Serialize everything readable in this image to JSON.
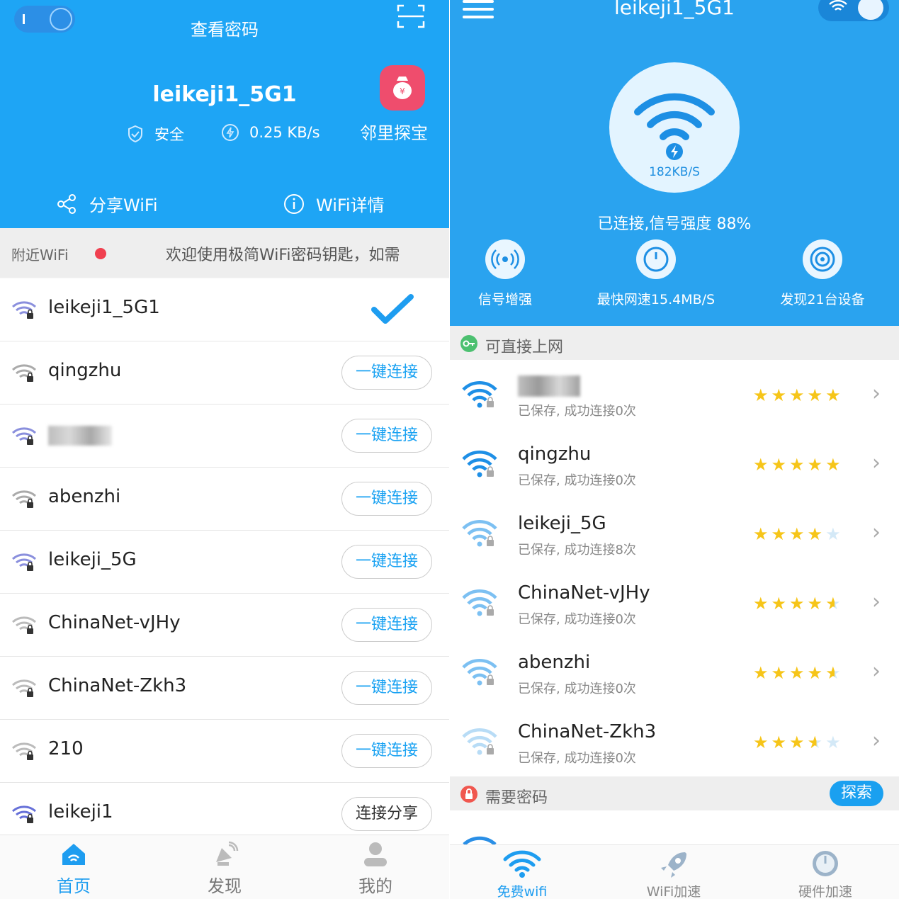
{
  "left": {
    "header": {
      "title": "查看密码",
      "ssid": "leikeji1_5G1",
      "security": "安全",
      "speed": "0.25 KB/s",
      "treasure_label": "邻里探宝",
      "share_label": "分享WiFi",
      "details_label": "WiFi详情",
      "colors": {
        "primary": "#1ea5f5",
        "treasure": "#ef4d6d"
      }
    },
    "nearby": {
      "label": "附近WiFi",
      "marquee": "欢迎使用极简WiFi密码钥匙，如需"
    },
    "networks": [
      {
        "name": "leikeji1_5G1",
        "action": "",
        "connected": true
      },
      {
        "name": "qingzhu",
        "action": "一键连接"
      },
      {
        "name": "",
        "action": "一键连接",
        "blurred": true
      },
      {
        "name": "abenzhi",
        "action": "一键连接"
      },
      {
        "name": "leikeji_5G",
        "action": "一键连接"
      },
      {
        "name": "ChinaNet-vJHy",
        "action": "一键连接"
      },
      {
        "name": "ChinaNet-Zkh3",
        "action": "一键连接"
      },
      {
        "name": "210",
        "action": "一键连接"
      },
      {
        "name": "leikeji1",
        "action": "连接分享"
      }
    ],
    "tabs": [
      {
        "label": "首页",
        "icon": "home-icon",
        "active": true
      },
      {
        "label": "发现",
        "icon": "satellite-icon"
      },
      {
        "label": "我的",
        "icon": "person-icon"
      }
    ]
  },
  "right": {
    "header": {
      "ssid": "leikeji1_5G1",
      "speed": "182KB/S",
      "status": "已连接,信号强度 88%",
      "features": [
        {
          "label": "信号增强",
          "icon": "signal-boost-icon"
        },
        {
          "label": "最快网速15.4MB/S",
          "icon": "speedometer-icon"
        },
        {
          "label": "发现21台设备",
          "icon": "devices-icon"
        }
      ],
      "colors": {
        "primary": "#2aa3ef"
      }
    },
    "section_direct": "可直接上网",
    "networks": [
      {
        "name": "",
        "sub": "已保存, 成功连接0次",
        "rating": 5,
        "blurred": true
      },
      {
        "name": "qingzhu",
        "sub": "已保存, 成功连接0次",
        "rating": 5
      },
      {
        "name": "leikeji_5G",
        "sub": "已保存, 成功连接8次",
        "rating": 4
      },
      {
        "name": "ChinaNet-vJHy",
        "sub": "已保存, 成功连接0次",
        "rating": 4.5
      },
      {
        "name": "abenzhi",
        "sub": "已保存, 成功连接0次",
        "rating": 4.5
      },
      {
        "name": "ChinaNet-Zkh3",
        "sub": "已保存, 成功连接0次",
        "rating": 3.5
      }
    ],
    "section_password": "需要密码",
    "explore_label": "探索",
    "tabs": [
      {
        "label": "免费wifi",
        "icon": "wifi-icon",
        "active": true
      },
      {
        "label": "WiFi加速",
        "icon": "rocket-icon"
      },
      {
        "label": "硬件加速",
        "icon": "gauge-icon"
      }
    ]
  }
}
